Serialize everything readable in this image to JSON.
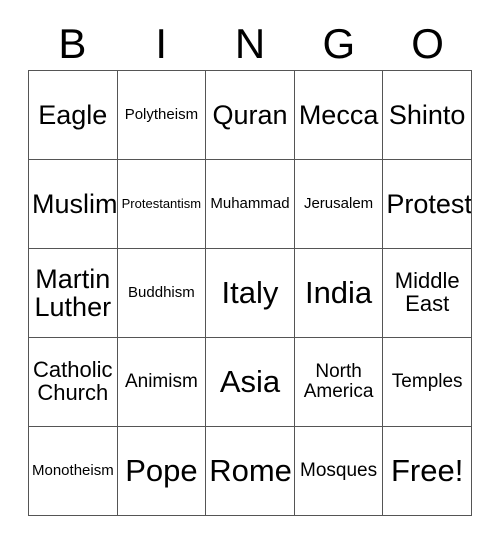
{
  "card": {
    "header_letters": [
      "B",
      "I",
      "N",
      "G",
      "O"
    ],
    "columns": 5,
    "rows": 5,
    "border_color": "#555555",
    "background_color": "#ffffff",
    "text_color": "#000000",
    "cells": [
      [
        {
          "text": "Eagle",
          "size": "fs-lg"
        },
        {
          "text": "Polytheism",
          "size": "fs-xs"
        },
        {
          "text": "Quran",
          "size": "fs-lg"
        },
        {
          "text": "Mecca",
          "size": "fs-lg"
        },
        {
          "text": "Shinto",
          "size": "fs-lg"
        }
      ],
      [
        {
          "text": "Muslim",
          "size": "fs-lg"
        },
        {
          "text": "Protestantism",
          "size": "fs-xxs"
        },
        {
          "text": "Muhammad",
          "size": "fs-xs"
        },
        {
          "text": "Jerusalem",
          "size": "fs-xs"
        },
        {
          "text": "Protest",
          "size": "fs-lg"
        }
      ],
      [
        {
          "text": "Martin\nLuther",
          "size": "fs-lg"
        },
        {
          "text": "Buddhism",
          "size": "fs-xs"
        },
        {
          "text": "Italy",
          "size": "fs-xl"
        },
        {
          "text": "India",
          "size": "fs-xl"
        },
        {
          "text": "Middle\nEast",
          "size": "fs-md"
        }
      ],
      [
        {
          "text": "Catholic\nChurch",
          "size": "fs-md"
        },
        {
          "text": "Animism",
          "size": "fs-sm"
        },
        {
          "text": "Asia",
          "size": "fs-xl"
        },
        {
          "text": "North\nAmerica",
          "size": "fs-sm"
        },
        {
          "text": "Temples",
          "size": "fs-sm"
        }
      ],
      [
        {
          "text": "Monotheism",
          "size": "fs-xs"
        },
        {
          "text": "Pope",
          "size": "fs-xl"
        },
        {
          "text": "Rome",
          "size": "fs-xl"
        },
        {
          "text": "Mosques",
          "size": "fs-sm"
        },
        {
          "text": "Free!",
          "size": "fs-xl"
        }
      ]
    ]
  }
}
